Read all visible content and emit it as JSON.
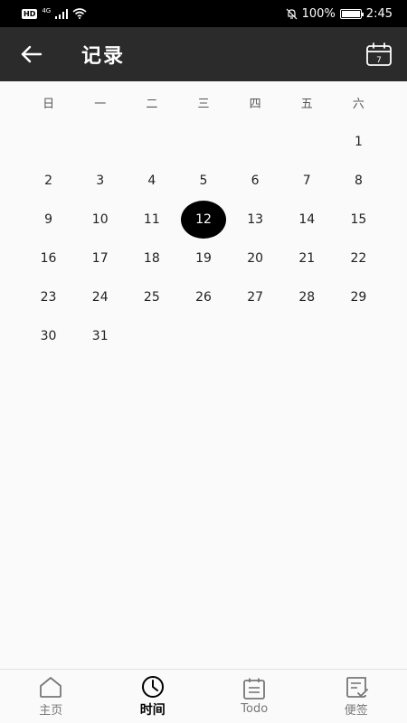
{
  "status_bar": {
    "hd": "HD",
    "network": "4G",
    "battery": "100%",
    "time": "2:45"
  },
  "app_bar": {
    "title": "记录",
    "calendar_day": "7"
  },
  "calendar": {
    "weekdays": [
      "日",
      "一",
      "二",
      "三",
      "四",
      "五",
      "六"
    ],
    "weeks": [
      [
        "",
        "",
        "",
        "",
        "",
        "",
        "1"
      ],
      [
        "2",
        "3",
        "4",
        "5",
        "6",
        "7",
        "8"
      ],
      [
        "9",
        "10",
        "11",
        "12",
        "13",
        "14",
        "15"
      ],
      [
        "16",
        "17",
        "18",
        "19",
        "20",
        "21",
        "22"
      ],
      [
        "23",
        "24",
        "25",
        "26",
        "27",
        "28",
        "29"
      ],
      [
        "30",
        "31",
        "",
        "",
        "",
        "",
        ""
      ]
    ],
    "selected": "12"
  },
  "bottom_nav": {
    "items": [
      {
        "label": "主页",
        "icon": "home-icon"
      },
      {
        "label": "时间",
        "icon": "clock-icon"
      },
      {
        "label": "Todo",
        "icon": "calendar-list-icon"
      },
      {
        "label": "便签",
        "icon": "note-check-icon"
      }
    ],
    "active": "时间"
  },
  "colors": {
    "app_bar_bg": "#2b2b2b",
    "selected_day_bg": "#000000",
    "page_bg": "#fafafa"
  }
}
